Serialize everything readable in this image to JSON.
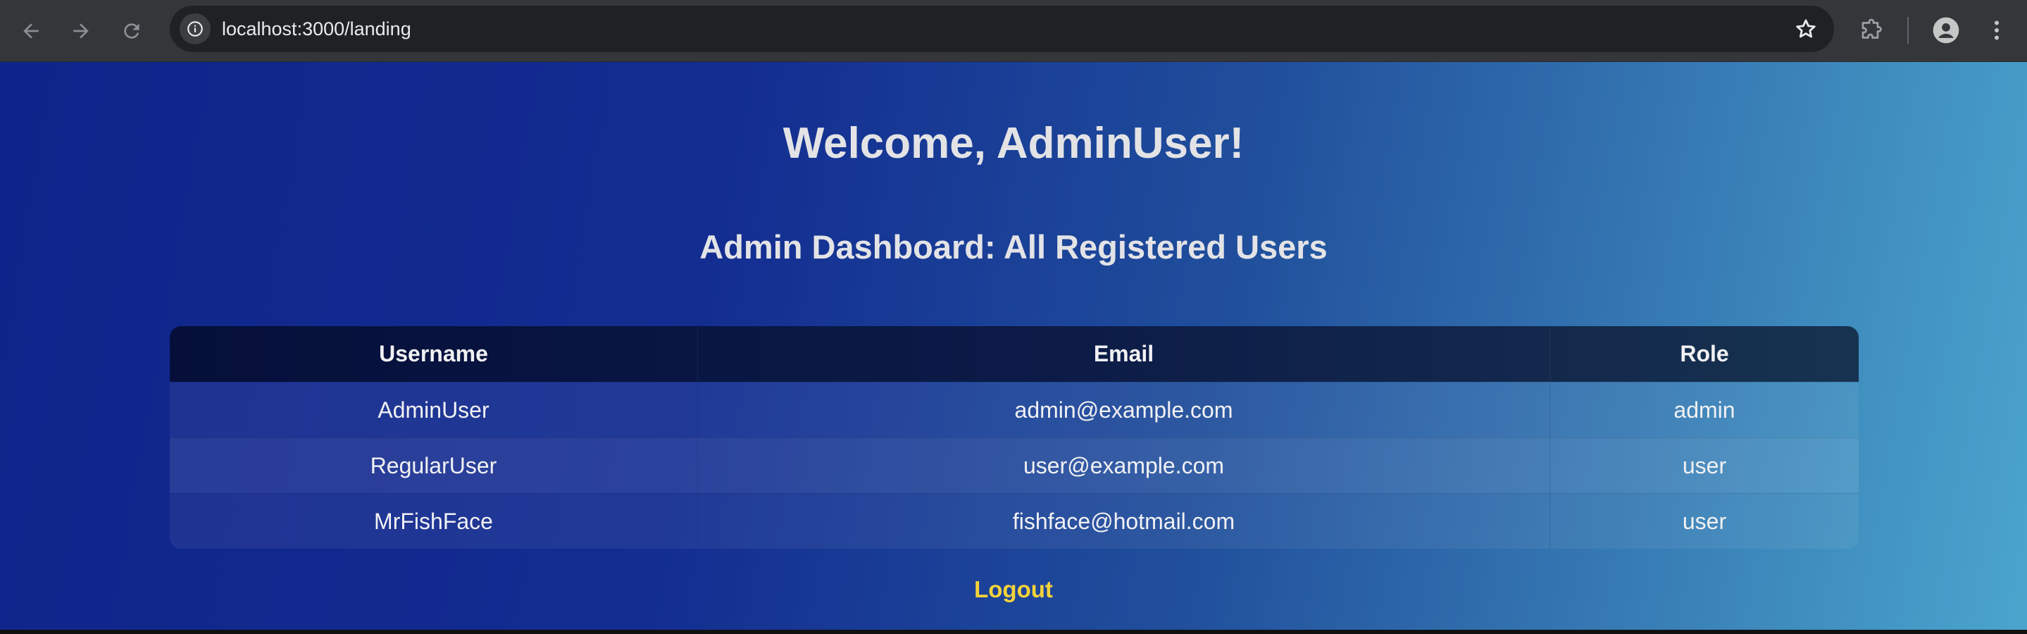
{
  "browser": {
    "url": "localhost:3000/landing",
    "icons": {
      "back": "back-arrow-icon",
      "forward": "forward-arrow-icon",
      "reload": "reload-icon",
      "site_info": "info-icon",
      "bookmark": "star-icon",
      "extensions": "puzzle-icon",
      "profile": "person-icon",
      "menu": "kebab-menu-icon"
    }
  },
  "page": {
    "welcome": "Welcome, AdminUser!",
    "subtitle": "Admin Dashboard: All Registered Users",
    "table": {
      "headers": [
        "Username",
        "Email",
        "Role"
      ],
      "rows": [
        {
          "username": "AdminUser",
          "email": "admin@example.com",
          "role": "admin"
        },
        {
          "username": "RegularUser",
          "email": "user@example.com",
          "role": "user"
        },
        {
          "username": "MrFishFace",
          "email": "fishface@hotmail.com",
          "role": "user"
        }
      ]
    },
    "logout_label": "Logout"
  },
  "colors": {
    "background_start": "#0f248a",
    "background_end": "#4aa5cd",
    "header_row": "#050f3a",
    "title_text": "#e3e3e6",
    "logout_text": "#f5d33a",
    "chrome_bg": "#35363a",
    "omnibox_bg": "#202124"
  }
}
